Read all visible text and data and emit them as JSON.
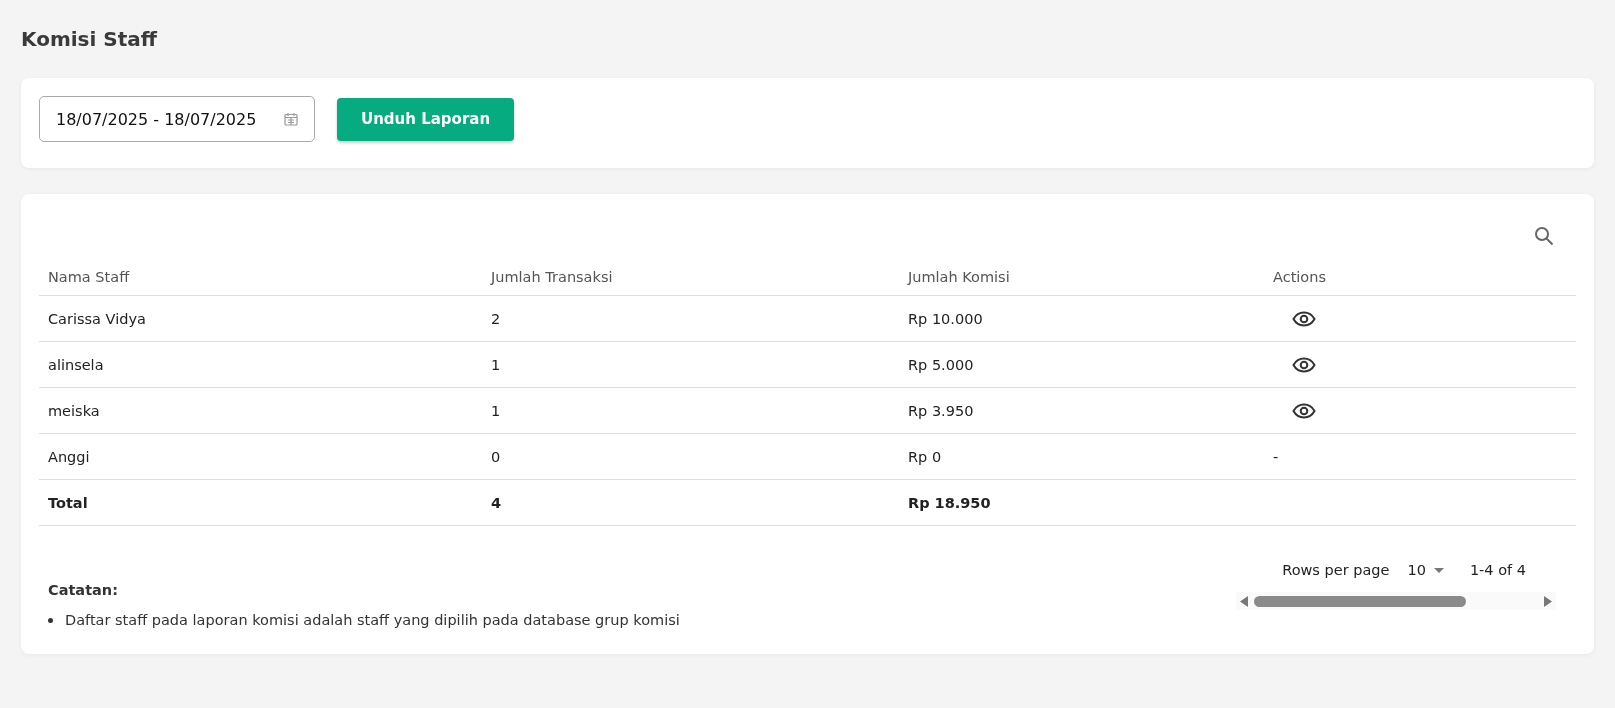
{
  "page_title": "Komisi Staff",
  "filter": {
    "date_range": "18/07/2025 - 18/07/2025",
    "download_button": "Unduh Laporan"
  },
  "table": {
    "columns": [
      "Nama Staff",
      "Jumlah Transaksi",
      "Jumlah Komisi",
      "Actions"
    ],
    "rows": [
      {
        "name": "Carissa Vidya",
        "transactions": "2",
        "commission": "Rp 10.000",
        "action": {
          "kind": "view"
        }
      },
      {
        "name": "alinsela",
        "transactions": "1",
        "commission": "Rp 5.000",
        "action": {
          "kind": "view"
        }
      },
      {
        "name": "meiska",
        "transactions": "1",
        "commission": "Rp 3.950",
        "action": {
          "kind": "view"
        }
      },
      {
        "name": "Anggi",
        "transactions": "0",
        "commission": "Rp 0",
        "action": {
          "kind": "text",
          "text": "-"
        }
      }
    ],
    "total": {
      "label": "Total",
      "transactions": "4",
      "commission": "Rp 18.950"
    }
  },
  "notes": {
    "title": "Catatan:",
    "items": [
      "Daftar staff pada laporan komisi adalah staff yang dipilih pada database grup komisi"
    ]
  },
  "pagination": {
    "rows_per_page_label": "Rows per page",
    "rows_per_page": "10",
    "range": "1-4 of 4"
  }
}
